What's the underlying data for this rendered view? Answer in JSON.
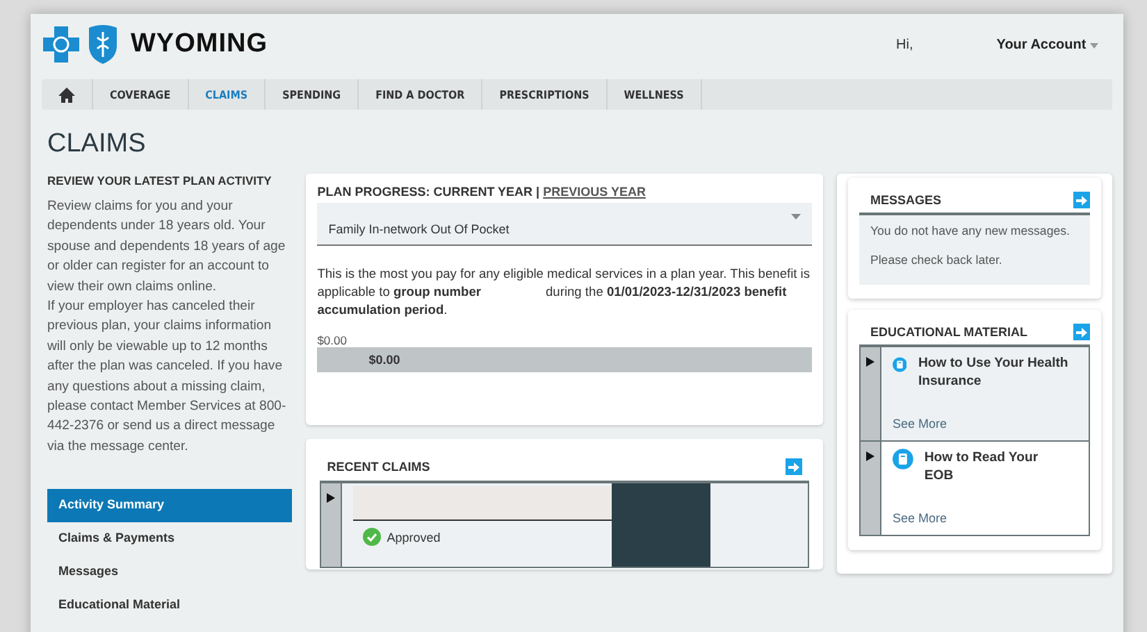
{
  "header": {
    "logo_text": "WYOMING",
    "greeting": "Hi,",
    "account_menu": "Your Account"
  },
  "nav": [
    {
      "kind": "home",
      "selected": false
    },
    {
      "kind": "text",
      "label": "COVERAGE",
      "selected": false
    },
    {
      "kind": "text",
      "label": "CLAIMS",
      "selected": true
    },
    {
      "kind": "text",
      "label": "SPENDING",
      "selected": false
    },
    {
      "kind": "text",
      "label": "FIND A DOCTOR",
      "selected": false
    },
    {
      "kind": "text",
      "label": "PRESCRIPTIONS",
      "selected": false
    },
    {
      "kind": "text",
      "label": "WELLNESS",
      "selected": false
    }
  ],
  "page_title": "CLAIMS",
  "sidebar": {
    "heading": "REVIEW YOUR LATEST PLAN ACTIVITY",
    "paragraphs": [
      "Review claims for you and your dependents under 18 years old. Your spouse and dependents 18 years of age or older can register for an account to view their own claims online.",
      "If your employer has canceled their previous plan, your claims information will only be viewable up to 12 months after the plan was canceled. If you have any questions about a missing claim, please contact Member Services at 800-442-2376 or send us a direct message via the message center."
    ],
    "items": [
      {
        "label": "Activity Summary",
        "selected": true
      },
      {
        "label": "Claims & Payments",
        "selected": false
      },
      {
        "label": "Messages",
        "selected": false
      },
      {
        "label": "Educational Material",
        "selected": false
      }
    ]
  },
  "plan_progress": {
    "heading": "PLAN PROGRESS: CURRENT YEAR |",
    "previous_year_link": "PREVIOUS YEAR",
    "dropdown_value": "Family In-network Out Of Pocket",
    "description": "This is the most you pay for any eligible medical services in a plan year. This benefit is applicable to **group number**                  during the **01/01/2023-12/31/2023 benefit accumulation period**.",
    "bar_label": "$0.00",
    "bar_value": "$0.00",
    "level": 0
  },
  "recent_claims": {
    "heading": "RECENT CLAIMS",
    "rows": [
      {
        "expanded": false,
        "status": "Approved"
      }
    ]
  },
  "messages": {
    "heading": "MESSAGES",
    "lines": [
      "You do not have any new messages.",
      "Please check back later."
    ]
  },
  "educational_material": {
    "heading": "EDUCATIONAL MATERIAL",
    "items": [
      {
        "title": "How to Use Your Health Insurance",
        "link": "See More",
        "selected": true,
        "expanded": false
      },
      {
        "title": "How to Read Your EOB",
        "link": "See More",
        "selected": false,
        "expanded": false
      }
    ]
  }
}
